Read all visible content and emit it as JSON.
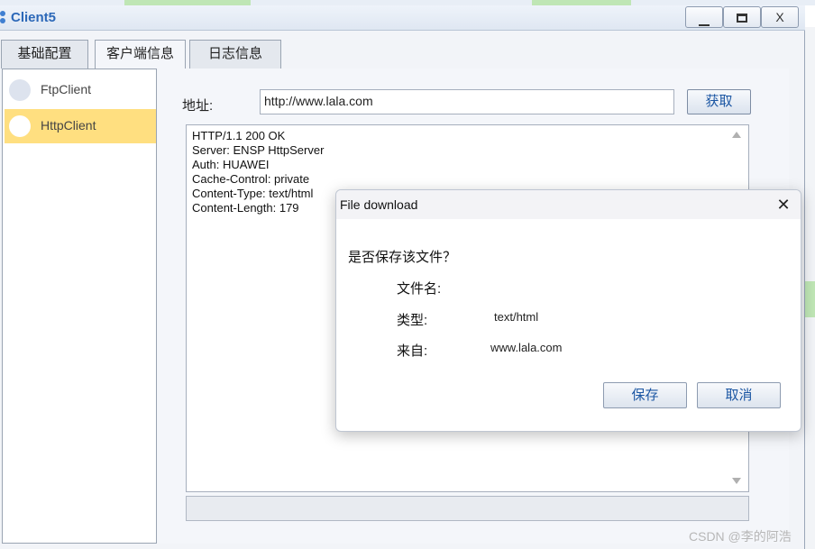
{
  "window": {
    "title": "Client5",
    "controls": {
      "minimize": "minimize",
      "maximize": "maximize",
      "close": "X"
    }
  },
  "tabs": [
    {
      "label": "基础配置"
    },
    {
      "label": "客户端信息"
    },
    {
      "label": "日志信息"
    }
  ],
  "client_list": [
    {
      "label": "FtpClient",
      "selected": false
    },
    {
      "label": "HttpClient",
      "selected": true
    }
  ],
  "http_client": {
    "address_label": "地址:",
    "url_value": "http://www.lala.com",
    "fetch_button": "获取",
    "response_lines": [
      "HTTP/1.1 200 OK",
      "Server: ENSP HttpServer",
      "Auth: HUAWEI",
      "Cache-Control: private",
      "Content-Type: text/html",
      "Content-Length: 179"
    ]
  },
  "dialog": {
    "title": "File download",
    "close_glyph": "✕",
    "question": "是否保存该文件？",
    "fields": {
      "file_name_label": "文件名:",
      "file_name_value": "",
      "type_label": "类型:",
      "type_value": "text/html",
      "from_label": "来自:",
      "from_value": "www.lala.com"
    },
    "save_button": "保存",
    "cancel_button": "取消"
  },
  "watermark": "CSDN @李的阿浩",
  "colors": {
    "title_blue": "#2c68b8",
    "selected_item": "#ffdf80",
    "button_text": "#1b56a3"
  }
}
